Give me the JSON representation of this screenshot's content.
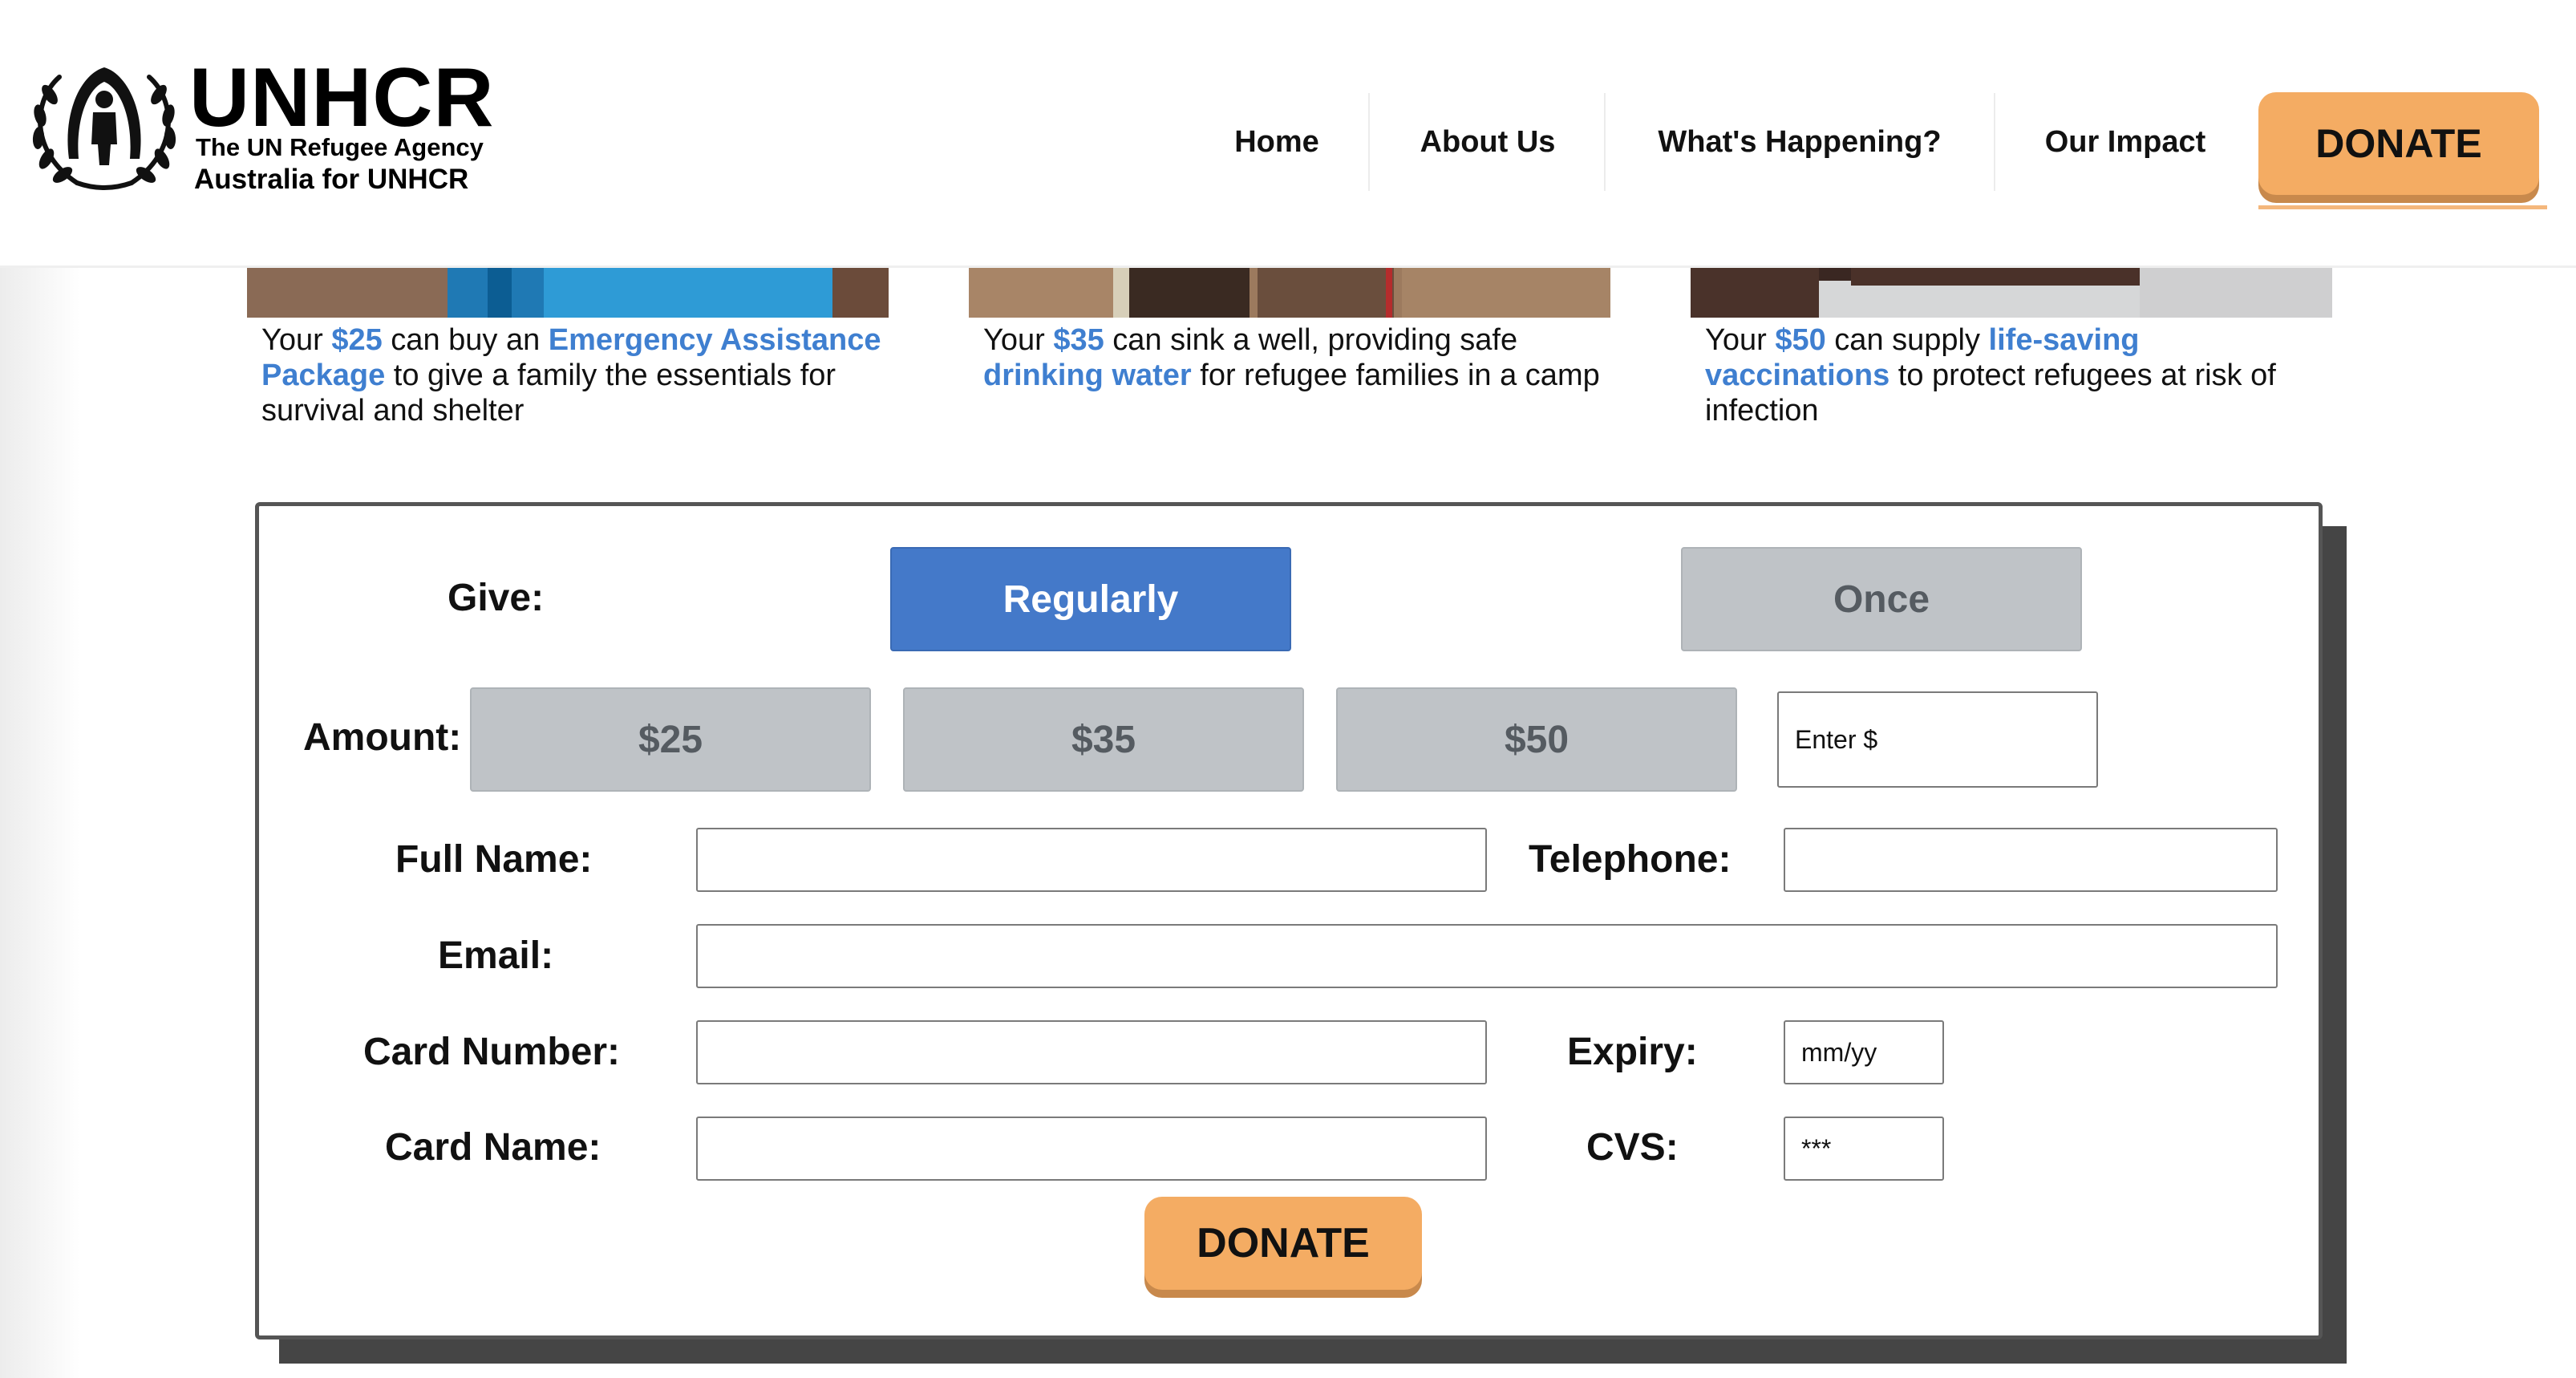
{
  "header": {
    "logo": {
      "title": "UNHCR",
      "subtitle": "The UN Refugee Agency",
      "tagline": "Australia for UNHCR"
    },
    "nav": [
      {
        "label": "Home"
      },
      {
        "label": "About Us"
      },
      {
        "label": "What's Happening?"
      },
      {
        "label": "Our Impact"
      }
    ],
    "donate_label": "DONATE"
  },
  "cards": [
    {
      "pre": "Your ",
      "amount": "$25",
      "mid": " can buy an ",
      "highlight": "Emergency Assistance Package",
      "post": " to give a family the essentials for survival and shelter"
    },
    {
      "pre": "Your ",
      "amount": "$35",
      "mid": " can sink a well, providing safe ",
      "highlight": "drinking water",
      "post": " for refugee families in a camp"
    },
    {
      "pre": "Your ",
      "amount": "$50",
      "mid": " can supply ",
      "highlight": "life-saving vaccinations",
      "post": " to protect refugees at risk of infection"
    }
  ],
  "form": {
    "give_label": "Give:",
    "frequency": {
      "regularly": "Regularly",
      "once": "Once",
      "selected": "Regularly"
    },
    "amount_label": "Amount:",
    "amounts": [
      "$25",
      "$35",
      "$50"
    ],
    "custom_amount_placeholder": "Enter $",
    "full_name_label": "Full Name:",
    "telephone_label": "Telephone:",
    "email_label": "Email:",
    "card_number_label": "Card Number:",
    "expiry_label": "Expiry:",
    "expiry_placeholder": "mm/yy",
    "card_name_label": "Card Name:",
    "cvs_label": "CVS:",
    "cvs_placeholder": "***",
    "submit_label": "DONATE"
  },
  "colors": {
    "accent_blue": "#4479c9",
    "link_blue": "#3f7fd0",
    "donate_orange": "#f4ac63",
    "muted_button": "#bfc3c7"
  }
}
